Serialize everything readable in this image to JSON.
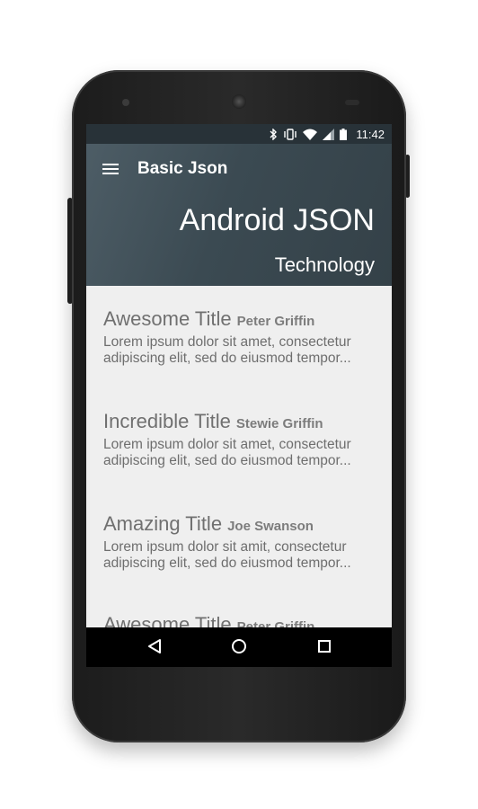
{
  "status_bar": {
    "time": "11:42",
    "icons": [
      "bluetooth-icon",
      "vibrate-icon",
      "wifi-icon",
      "signal-icon",
      "battery-icon"
    ]
  },
  "toolbar": {
    "title": "Basic Json",
    "menu_icon": "hamburger-menu-icon"
  },
  "header": {
    "title": "Android JSON",
    "subtitle": "Technology"
  },
  "items": [
    {
      "title": "Awesome Title",
      "author": "Peter Griffin",
      "line1": "Lorem ipsum dolor sit amet, consectetur",
      "line2": "adipiscing elit, sed do eiusmod tempor..."
    },
    {
      "title": "Incredible Title",
      "author": "Stewie Griffin",
      "line1": "Lorem ipsum dolor sit amet, consectetur",
      "line2": "adipiscing elit, sed do eiusmod tempor..."
    },
    {
      "title": "Amazing Title",
      "author": "Joe Swanson",
      "line1": "Lorem ipsum dolor sit amit, consectetur",
      "line2": "adipiscing elit, sed do eiusmod tempor..."
    },
    {
      "title": "Awesome Title",
      "author": "Peter Griffin",
      "line1": "",
      "line2": ""
    }
  ],
  "nav_bar": {
    "icons": [
      "back-icon",
      "home-icon",
      "recents-icon"
    ]
  },
  "colors": {
    "app_bar": "#3b4a52",
    "status_bar": "#283238",
    "background": "#efefef",
    "text": "#707070"
  }
}
